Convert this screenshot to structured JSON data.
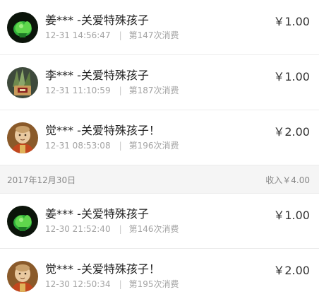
{
  "records": [
    {
      "name": "姜*** -关爱特殊孩子",
      "time": "12-31 14:56:47",
      "count": "第147次消费",
      "amount": "￥1.00",
      "avatar": "green-plant-avatar"
    },
    {
      "name": "李*** -关爱特殊孩子",
      "time": "12-31 11:10:59",
      "count": "第187次消费",
      "amount": "￥1.00",
      "avatar": "potted-plant-avatar"
    },
    {
      "name": "觉*** -关爱特殊孩子！",
      "time": "12-31 08:53:08",
      "count": "第196次消费",
      "amount": "￥2.00",
      "avatar": "buddha-avatar"
    }
  ],
  "date_group": {
    "date": "2017年12月30日",
    "income": "收入￥4.00"
  },
  "records2": [
    {
      "name": "姜*** -关爱特殊孩子",
      "time": "12-30 21:52:40",
      "count": "第146次消费",
      "amount": "￥1.00",
      "avatar": "green-plant-avatar"
    },
    {
      "name": "觉*** -关爱特殊孩子！",
      "time": "12-30 12:50:34",
      "count": "第195次消费",
      "amount": "￥2.00",
      "avatar": "buddha-avatar"
    }
  ],
  "separator": "|"
}
